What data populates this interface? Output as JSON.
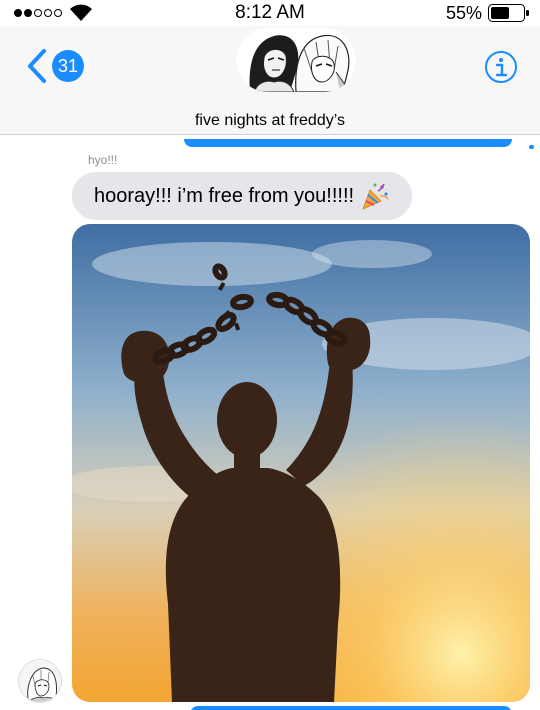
{
  "status_bar": {
    "time": "8:12 AM",
    "battery_percent": "55%",
    "signal_bars": 2,
    "signal_total": 5,
    "battery_level": 0.55
  },
  "header": {
    "back_badge_count": "31",
    "conversation_title": "five nights at freddy’s",
    "icons": {
      "back": "chevron-left-icon",
      "info": "info-icon"
    }
  },
  "messages": [
    {
      "sender": "hyo!!!",
      "text": "hooray!!! i’m free from you!!!!!",
      "emoji": "party-popper-icon"
    }
  ],
  "colors": {
    "accent": "#1a8cff",
    "incoming_bubble": "#e5e5ea",
    "header_bg": "#f7f7f7",
    "sender_name": "#8e8e93"
  }
}
